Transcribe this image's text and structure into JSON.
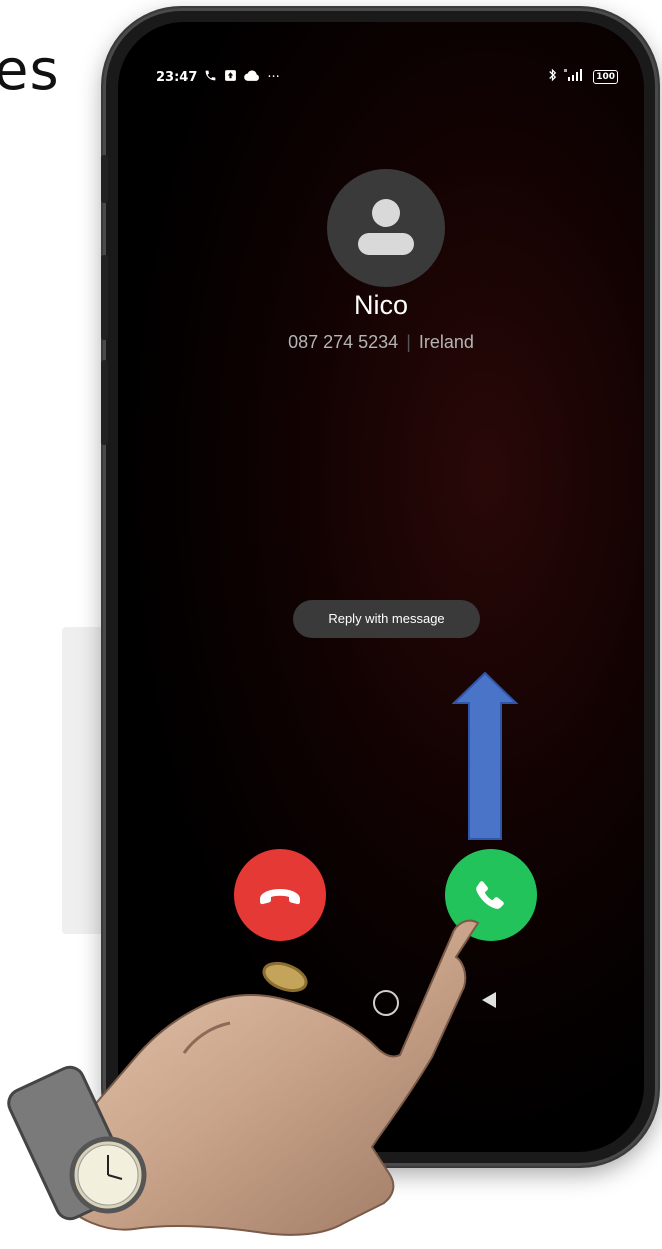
{
  "page": {
    "partial_heading": "es"
  },
  "status_bar": {
    "time": "23:47",
    "icons": [
      "phone-icon",
      "upload-icon",
      "cloud-icon",
      "more-dots-icon"
    ],
    "more_dots": "···",
    "right_icons": [
      "bluetooth-icon",
      "signal-icon"
    ],
    "battery": "100"
  },
  "call": {
    "caller_name": "Nico",
    "phone_number": "087 274 5234",
    "location": "Ireland",
    "reply_label": "Reply with message"
  },
  "buttons": {
    "decline_icon": "phone-hangup-icon",
    "accept_icon": "phone-answer-icon"
  },
  "annotation": {
    "arrow_direction": "up",
    "arrow_color": "#4a74c8"
  },
  "colors": {
    "decline": "#e53935",
    "accept": "#22c35a",
    "screen_bg": "#000000"
  }
}
